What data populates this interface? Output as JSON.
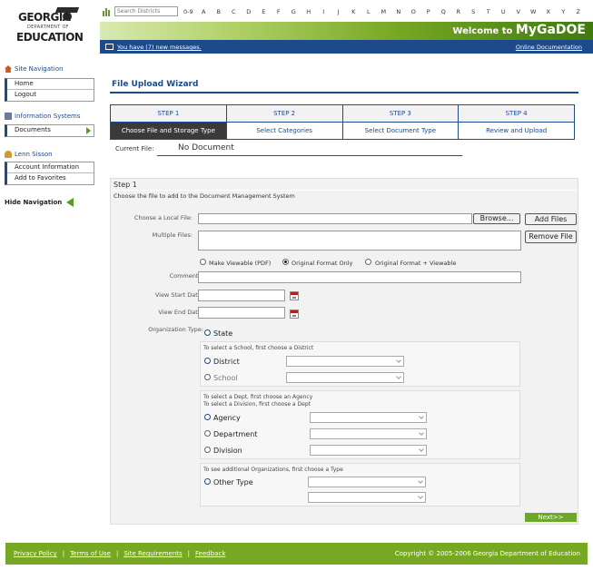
{
  "logo": {
    "top": "GEORGIA",
    "sub": "DEPARTMENT OF",
    "bottom": "EDUCATION"
  },
  "search": {
    "placeholder": "Search Districts",
    "digits": "0-9",
    "letters": [
      "A",
      "B",
      "C",
      "D",
      "E",
      "F",
      "G",
      "H",
      "I",
      "J",
      "K",
      "L",
      "M",
      "N",
      "O",
      "P",
      "Q",
      "R",
      "S",
      "T",
      "U",
      "V",
      "W",
      "X",
      "Y",
      "Z"
    ]
  },
  "banner": {
    "welcome_prefix": "Welcome to ",
    "welcome_app": "MyGaDOE",
    "messages": "You have (7) new messages.",
    "docs_link": "Online Documentation"
  },
  "sidebar": {
    "site_nav_heading": "Site Navigation",
    "site_nav_items": [
      "Home",
      "Logout"
    ],
    "info_heading": "Information Systems",
    "info_items": [
      "Documents"
    ],
    "user_heading": "Lenn Sisson",
    "user_items": [
      "Account Information",
      "Add to Favorites"
    ],
    "hide_nav": "Hide Navigation"
  },
  "wizard": {
    "title": "File Upload Wizard",
    "steps": [
      {
        "num": "STEP 1",
        "label": "Choose File and Storage Type",
        "active": true
      },
      {
        "num": "STEP 2",
        "label": "Select Categories",
        "active": false
      },
      {
        "num": "STEP 3",
        "label": "Select Document Type",
        "active": false
      },
      {
        "num": "STEP 4",
        "label": "Review and Upload",
        "active": false
      }
    ],
    "current_file_label": "Current File:",
    "current_file_value": "No Document"
  },
  "form": {
    "step_title": "Step 1",
    "step_desc": "Choose the file to add to the Document Management System",
    "local_file_label": "Choose a Local File:",
    "browse_label": "Browse...",
    "add_files_label": "Add Files",
    "multiple_files_label": "Multiple Files:",
    "remove_file_label": "Remove File",
    "storage_options": [
      "Make Viewable (PDF)",
      "Original Format Only",
      "Original Format + Viewable"
    ],
    "storage_selected": 1,
    "comments_label": "Comments:",
    "start_date_label": "View Start Date:",
    "end_date_label": "View End Date:",
    "org_type_label": "Organization Type:",
    "org_state": "State",
    "school_hint": "To select a School, first choose a District",
    "district": "District",
    "school": "School",
    "dept_hint_1": "To select a Dept, first choose an Agency",
    "dept_hint_2": "To select a Division, first choose a Dept",
    "agency": "Agency",
    "department": "Department",
    "division": "Division",
    "other_hint": "To see additional Organizations, first choose a Type",
    "other_type": "Other Type",
    "next_label": "Next>>"
  },
  "footer": {
    "links": [
      "Privacy Policy",
      "Terms of Use",
      "Site Requirements",
      "Feedback"
    ],
    "copyright": "Copyright © 2005-2006 Georgia Department of Education"
  },
  "colors": {
    "brand_blue": "#1d4a8a",
    "brand_green": "#77a824"
  }
}
